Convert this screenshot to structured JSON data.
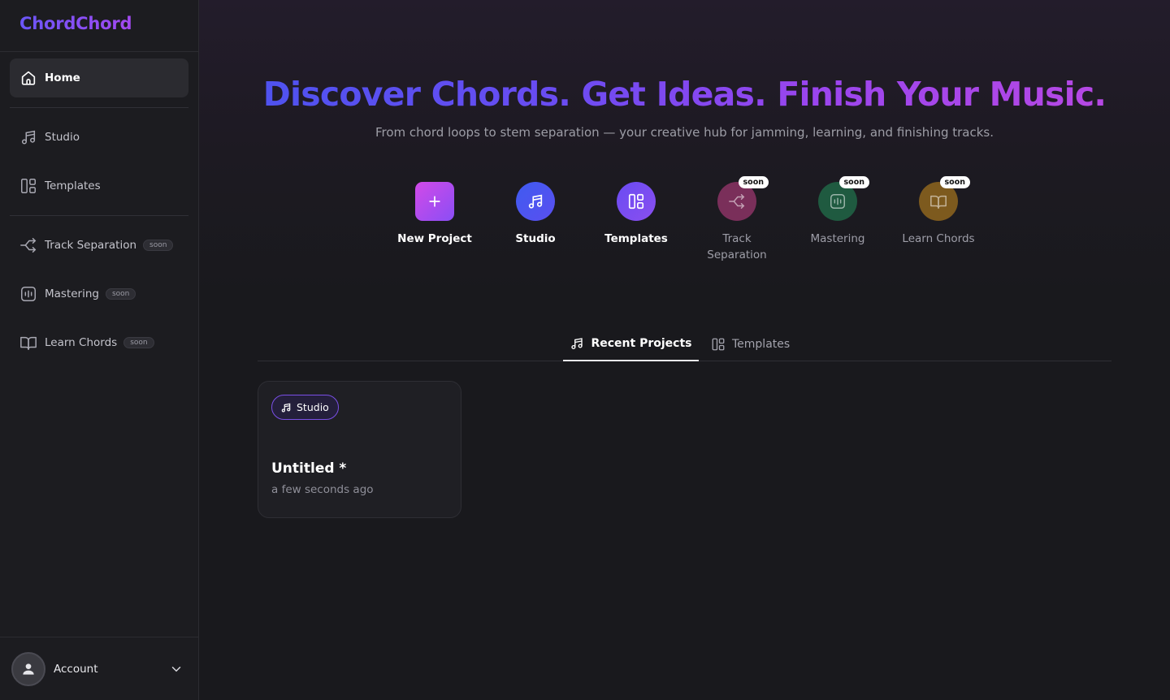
{
  "app": {
    "brand": "ChordChord"
  },
  "sidebar": {
    "items": [
      {
        "label": "Home",
        "icon": "home-icon"
      },
      {
        "label": "Studio",
        "icon": "music-note-icon"
      },
      {
        "label": "Templates",
        "icon": "templates-icon"
      },
      {
        "label": "Track Separation",
        "icon": "split-icon",
        "badge": "soon"
      },
      {
        "label": "Mastering",
        "icon": "waveform-icon",
        "badge": "soon"
      },
      {
        "label": "Learn Chords",
        "icon": "book-icon",
        "badge": "soon"
      }
    ],
    "account": {
      "label": "Account",
      "icon": "user-icon"
    }
  },
  "hero": {
    "title": "Discover Chords. Get Ideas. Finish Your Music.",
    "subtitle": "From chord loops to stem separation — your creative hub for jamming, learning, and finishing tracks."
  },
  "actions": [
    {
      "label": "New Project",
      "icon": "plus-icon",
      "color": "#c446f0"
    },
    {
      "label": "Studio",
      "icon": "music-note-icon",
      "color": "#4b56ee"
    },
    {
      "label": "Templates",
      "icon": "templates-icon",
      "color": "#7a4df0"
    },
    {
      "label": "Track Separation",
      "icon": "split-icon",
      "color": "#7a2f5a",
      "badge": "soon"
    },
    {
      "label": "Mastering",
      "icon": "waveform-icon",
      "color": "#1f5a40",
      "badge": "soon"
    },
    {
      "label": "Learn Chords",
      "icon": "book-icon",
      "color": "#7d5a1e",
      "badge": "soon"
    }
  ],
  "tabs": [
    {
      "label": "Recent Projects",
      "icon": "music-note-icon",
      "active": true
    },
    {
      "label": "Templates",
      "icon": "templates-icon",
      "active": false
    }
  ],
  "projects": [
    {
      "tag": "Studio",
      "title": "Untitled *",
      "time": "a few seconds ago"
    }
  ]
}
